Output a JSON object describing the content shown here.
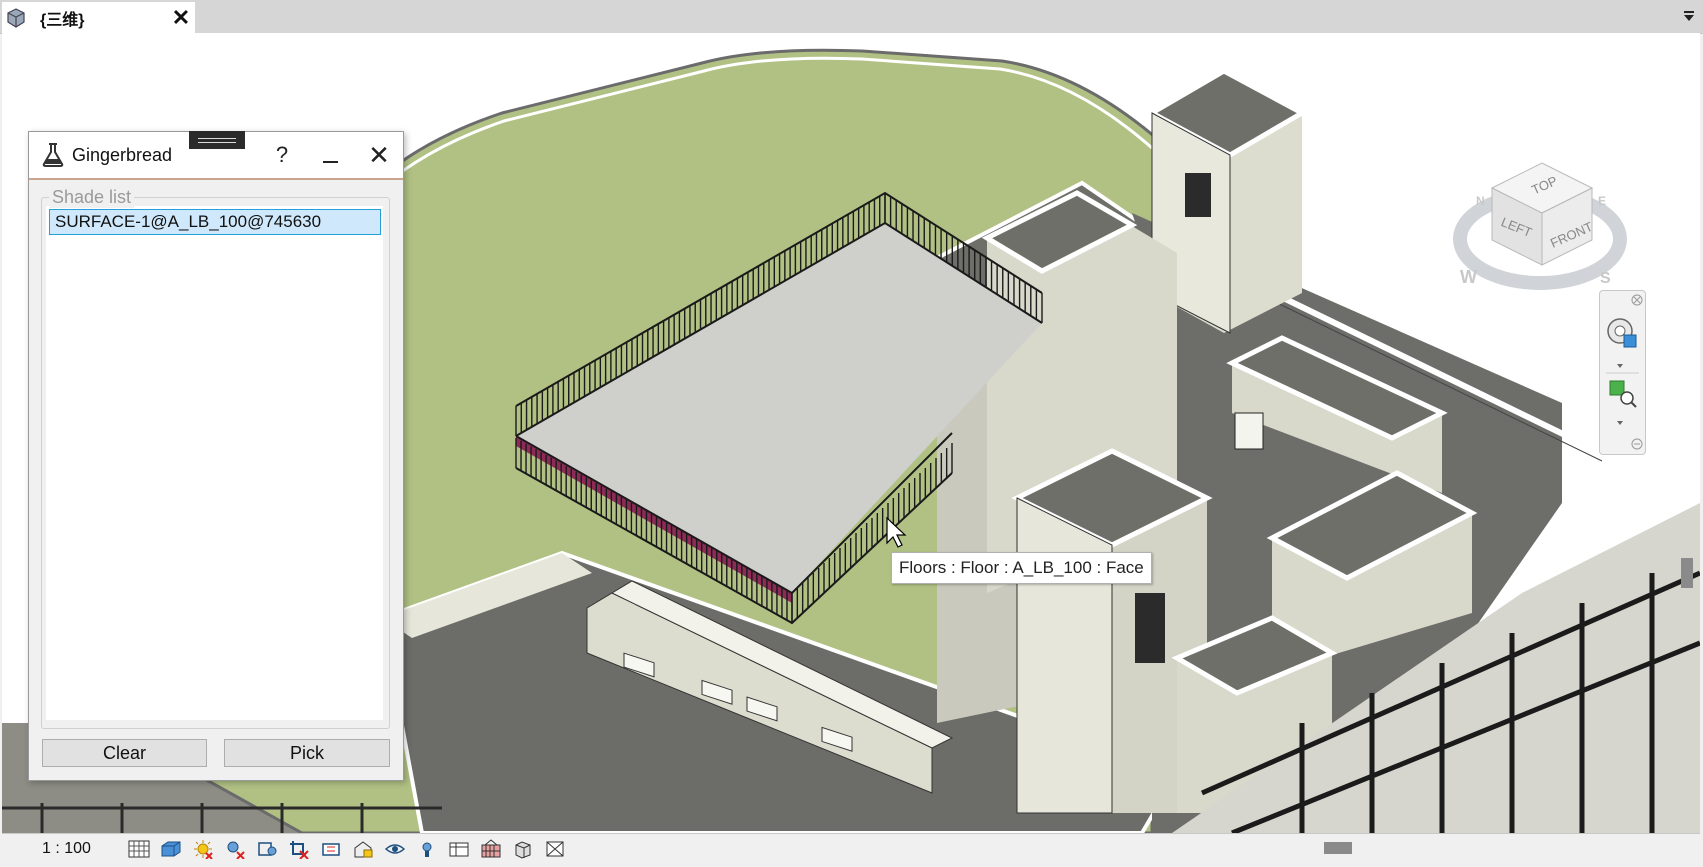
{
  "tab": {
    "title": "{三维}",
    "close_glyph": "✕",
    "icon": "3d-view-icon"
  },
  "dialog": {
    "title": "Gingerbread",
    "help": "?",
    "close": "✕",
    "group_label": "Shade list",
    "items": [
      "SURFACE-1@A_LB_100@745630"
    ],
    "buttons": {
      "clear": "Clear",
      "pick": "Pick"
    }
  },
  "tooltip": "Floors : Floor : A_LB_100 : Face",
  "viewcube": {
    "top": "TOP",
    "left": "LEFT",
    "front": "FRONT",
    "west": "W",
    "south": "S",
    "north": "N",
    "east": "E"
  },
  "status": {
    "scale": "1 : 100",
    "icons": [
      "detail-level-icon",
      "visual-style-icon",
      "sun-path-icon",
      "shadows-icon",
      "render-icon",
      "crop-view-icon",
      "show-crop-icon",
      "unlock-3d-icon",
      "temporary-hide-icon",
      "reveal-hidden-icon",
      "worksharing-icon",
      "design-options-icon",
      "analytical-model-icon",
      "highlight-boundaries-icon"
    ]
  },
  "colors": {
    "ground": "#b1c184",
    "roof": "#6f6f6a",
    "wall": "#e6e6da",
    "selection": "#cfe8fb",
    "selection_border": "#26a0da"
  }
}
